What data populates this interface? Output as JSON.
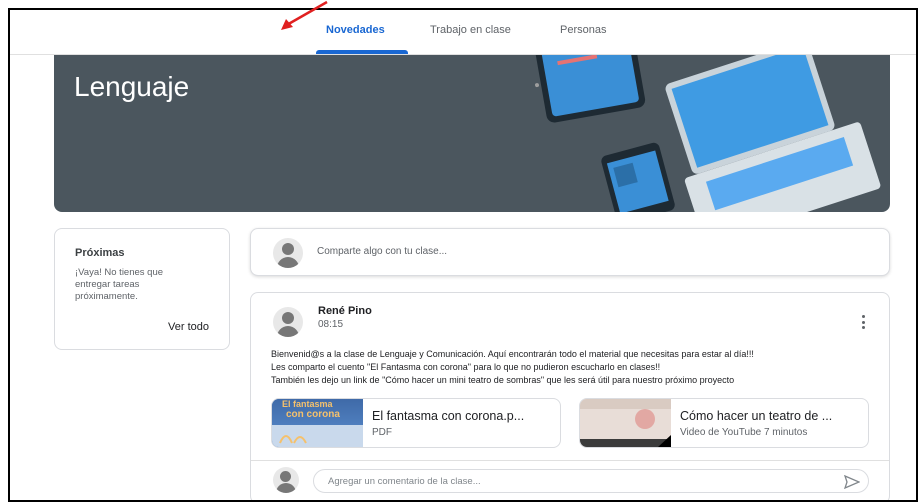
{
  "tabs": [
    {
      "label": "Novedades",
      "active": true
    },
    {
      "label": "Trabajo en clase",
      "active": false
    },
    {
      "label": "Personas",
      "active": false
    }
  ],
  "banner": {
    "title": "Lenguaje",
    "background_color": "#4b565e"
  },
  "upcoming": {
    "title": "Próximas",
    "empty_text": "¡Vaya! No tienes que entregar tareas próximamente.",
    "view_all_label": "Ver todo"
  },
  "share_box": {
    "placeholder": "Comparte algo con tu clase..."
  },
  "post": {
    "author": "René Pino",
    "time": "08:15",
    "body_lines": [
      "Bienvenid@s a la clase de Lenguaje y Comunicación. Aquí encontrarán todo el material que necesitas para estar al día!!!",
      "Les comparto el cuento \"El Fantasma con corona\" para lo que no pudieron escucharlo en clases!!",
      "También les dejo un link de \"Cómo hacer un mini teatro de sombras\" que les será útil para nuestro próximo proyecto"
    ],
    "attachments": [
      {
        "title": "El fantasma con corona.p...",
        "subtitle": "PDF",
        "thumb_text_top": "El fantasma",
        "thumb_text_main": "con corona",
        "icon": "pdf-thumbnail"
      },
      {
        "title": "Cómo hacer un teatro de ...",
        "subtitle": "Video de YouTube  7 minutos",
        "icon": "video-thumbnail"
      }
    ],
    "comment_placeholder": "Agregar un comentario de la clase..."
  },
  "colors": {
    "accent": "#1967d2",
    "annotation_arrow": "#e02020"
  }
}
